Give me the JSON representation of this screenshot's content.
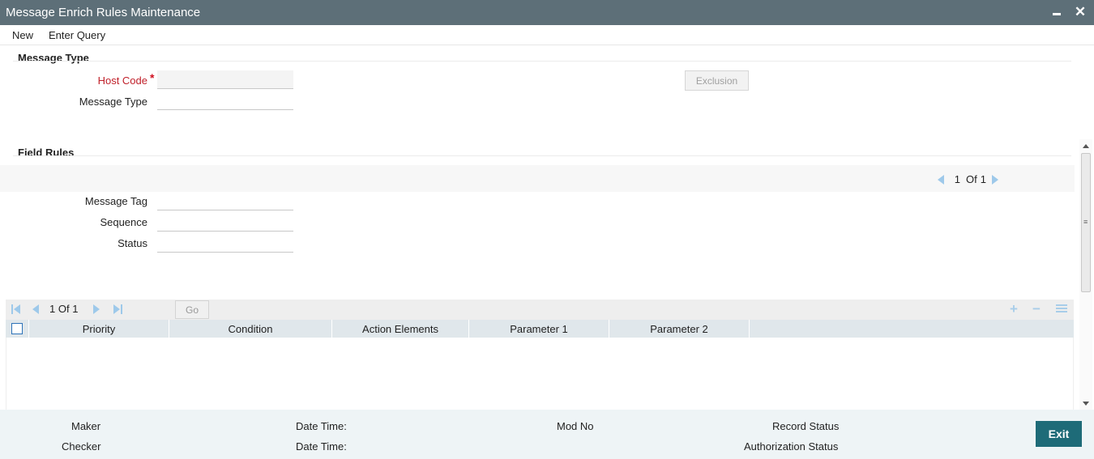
{
  "window": {
    "title": "Message Enrich Rules Maintenance"
  },
  "menu": {
    "items": [
      "New",
      "Enter Query"
    ]
  },
  "message_type_section": {
    "heading": "Message Type",
    "host_code_label": "Host Code",
    "required_mark": "*",
    "host_code_value": "",
    "message_type_label": "Message Type",
    "message_type_value": "",
    "exclusion_button": "Exclusion"
  },
  "field_rules_section": {
    "heading": "Field Rules",
    "pager": {
      "current": "1",
      "of_label": "Of",
      "total": "1"
    },
    "message_tag_label": "Message Tag",
    "message_tag_value": "",
    "sequence_label": "Sequence",
    "sequence_value": "",
    "status_label": "Status",
    "status_value": ""
  },
  "grid": {
    "pager": {
      "current": "1",
      "of_label": "Of",
      "total": "1"
    },
    "go_button": "Go",
    "add_symbol": "+",
    "remove_symbol": "−",
    "columns": [
      "Priority",
      "Condition",
      "Action Elements",
      "Parameter 1",
      "Parameter 2"
    ],
    "rows": []
  },
  "footer": {
    "maker_label": "Maker",
    "checker_label": "Checker",
    "date_time_label_1": "Date Time:",
    "date_time_label_2": "Date Time:",
    "mod_no_label": "Mod No",
    "record_status_label": "Record Status",
    "authorization_status_label": "Authorization Status",
    "exit_button": "Exit"
  },
  "colors": {
    "titlebar_bg": "#5d6f78",
    "exit_button_bg": "#1e6b78",
    "required_red": "#c0202a",
    "footer_bg": "#eef4f6",
    "grid_header_bg": "#e0e7eb"
  },
  "icons": {
    "minimize": "minimize-icon",
    "close": "close-icon",
    "prev": "prev-page-icon",
    "next": "next-page-icon",
    "first": "first-page-icon",
    "last": "last-page-icon",
    "add_row": "add-row-icon",
    "remove_row": "remove-row-icon",
    "settings": "grid-settings-icon"
  }
}
